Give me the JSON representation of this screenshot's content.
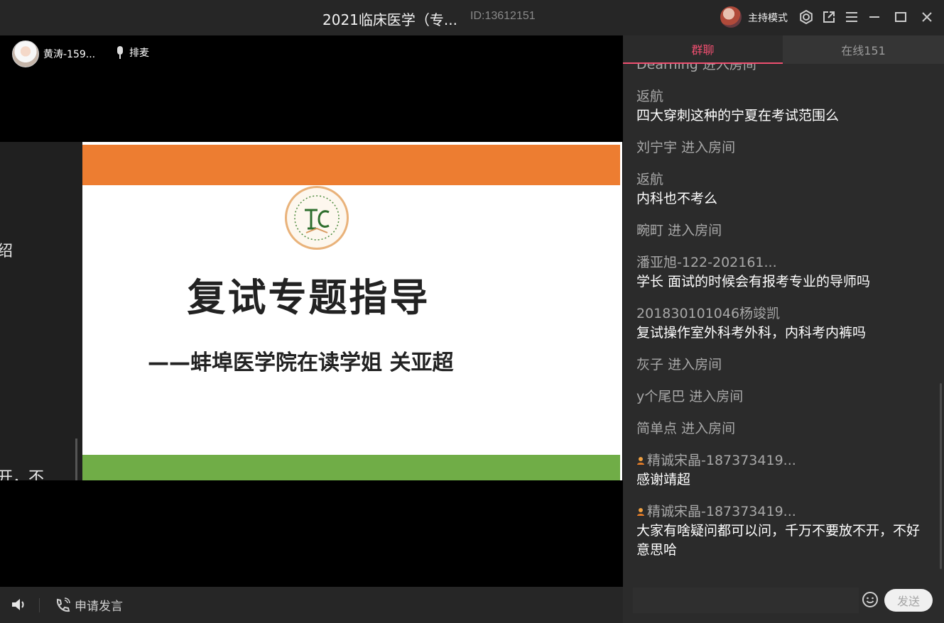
{
  "window": {
    "title": "2021临床医学（专...",
    "room_id": "ID:13612151",
    "host_mode": "主持模式"
  },
  "video": {
    "presenter_name": "黄涛-159...",
    "mic_queue_label": "排麦",
    "share_edge_texts": [
      "绍",
      "开，不"
    ],
    "slide": {
      "heading": "复试专题指导",
      "subtitle": "——蚌埠医学院在读学姐  关亚超"
    }
  },
  "bottombar": {
    "apply_speak_label": "申请发言"
  },
  "chat": {
    "tabs": [
      {
        "label": "群聊",
        "active": true
      },
      {
        "label": "在线151",
        "active": false
      }
    ],
    "messages": [
      {
        "user": "Dearning",
        "system": "进入房间"
      },
      {
        "user": "返航",
        "text": "四大穿刺这种的宁夏在考试范围么"
      },
      {
        "user": "刘宁宇",
        "system": "进入房间"
      },
      {
        "user": "返航",
        "text": "内科也不考么"
      },
      {
        "user": "畹町",
        "system": "进入房间"
      },
      {
        "user": "潘亚旭-122-202161...",
        "text": "学长 面试的时候会有报考专业的导师吗"
      },
      {
        "user": "201830101046杨竣凯",
        "text": "复试操作室外科考外科，内科考内裤吗"
      },
      {
        "user": "灰子",
        "system": "进入房间"
      },
      {
        "user": "y个尾巴",
        "system": "进入房间"
      },
      {
        "user": "简单点",
        "system": "进入房间"
      },
      {
        "user": "精诚宋晶-187373419...",
        "text": "感谢靖超",
        "badge": true
      },
      {
        "user": "精诚宋晶-187373419...",
        "text": "大家有啥疑问都可以问，千万不要放不开，不好意思哈",
        "badge": true
      }
    ],
    "input_placeholder": "",
    "send_label": "发送"
  },
  "colors": {
    "accent_pink": "#ef4f70",
    "slide_orange": "#ed7d31",
    "slide_green": "#70ad47"
  }
}
